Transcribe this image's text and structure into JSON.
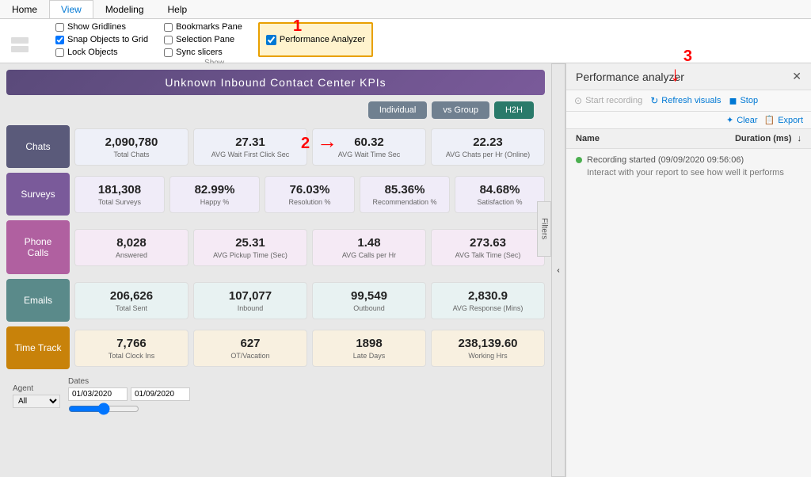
{
  "ribbon": {
    "tabs": [
      "Home",
      "View",
      "Modeling",
      "Help"
    ],
    "active_tab": "View",
    "show_group": {
      "title": "Show",
      "items": [
        {
          "label": "Show Gridlines",
          "checked": false
        },
        {
          "label": "Snap Objects to Grid",
          "checked": true
        },
        {
          "label": "Lock Objects",
          "checked": false
        },
        {
          "label": "Bookmarks Pane",
          "checked": false
        },
        {
          "label": "Selection Pane",
          "checked": false
        },
        {
          "label": "Sync slicers",
          "checked": false
        },
        {
          "label": "Performance Analyzer",
          "checked": true
        }
      ]
    }
  },
  "annotations": {
    "num1": "1",
    "num2": "2",
    "num3": "3"
  },
  "dashboard": {
    "title": "Unknown Inbound Contact Center KPIs",
    "filter_buttons": [
      {
        "label": "Individual",
        "type": "individual"
      },
      {
        "label": "vs Group",
        "type": "vs-group"
      },
      {
        "label": "H2H",
        "type": "h2h"
      }
    ],
    "sections": [
      {
        "label": "Chats",
        "style": "chats",
        "metrics": [
          {
            "value": "2,090,780",
            "label": "Total Chats"
          },
          {
            "value": "27.31",
            "label": "AVG Wait First Click Sec"
          },
          {
            "value": "60.32",
            "label": "AVG Wait Time Sec"
          },
          {
            "value": "22.23",
            "label": "AVG Chats per Hr (Online)"
          }
        ]
      },
      {
        "label": "Surveys",
        "style": "surveys",
        "metrics": [
          {
            "value": "181,308",
            "label": "Total Surveys"
          },
          {
            "value": "82.99%",
            "label": "Happy %"
          },
          {
            "value": "76.03%",
            "label": "Resolution %"
          },
          {
            "value": "85.36%",
            "label": "Recommendation %"
          },
          {
            "value": "84.68%",
            "label": "Satisfaction %"
          }
        ]
      },
      {
        "label": "Phone Calls",
        "style": "phone",
        "metrics": [
          {
            "value": "8,028",
            "label": "Answered"
          },
          {
            "value": "25.31",
            "label": "AVG Pickup Time (Sec)"
          },
          {
            "value": "1.48",
            "label": "AVG Calls per Hr"
          },
          {
            "value": "273.63",
            "label": "AVG Talk Time (Sec)"
          }
        ]
      },
      {
        "label": "Emails",
        "style": "emails",
        "metrics": [
          {
            "value": "206,626",
            "label": "Total Sent"
          },
          {
            "value": "107,077",
            "label": "Inbound"
          },
          {
            "value": "99,549",
            "label": "Outbound"
          },
          {
            "value": "2,830.9",
            "label": "AVG Response (Mins)"
          }
        ]
      },
      {
        "label": "Time Track",
        "style": "timetrack",
        "metrics": [
          {
            "value": "7,766",
            "label": "Total Clock Ins"
          },
          {
            "value": "627",
            "label": "OT/Vacation"
          },
          {
            "value": "1898",
            "label": "Late Days"
          },
          {
            "value": "238,139.60",
            "label": "Working Hrs"
          }
        ]
      }
    ],
    "bottom_controls": {
      "agent_label": "Agent",
      "agent_value": "All",
      "dates_label": "Dates",
      "date_start": "01/03/2020",
      "date_end": "01/09/2020"
    }
  },
  "perf_panel": {
    "title": "Performance analyzer",
    "buttons": {
      "start_recording": "Start recording",
      "refresh_visuals": "Refresh visuals",
      "stop": "Stop",
      "clear": "Clear",
      "export": "Export"
    },
    "table": {
      "col_name": "Name",
      "col_duration": "Duration (ms)"
    },
    "recording_info": "Recording started (09/09/2020 09:56:06)",
    "interact_hint": "Interact with your report to see how well it performs"
  }
}
